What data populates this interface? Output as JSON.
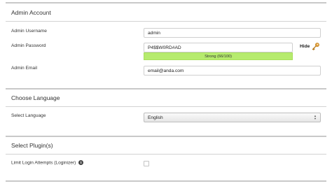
{
  "admin_account": {
    "title": "Admin Account",
    "username": {
      "label": "Admin Username",
      "value": "admin"
    },
    "password": {
      "label": "Admin Password",
      "value": "P4$$W0RD#AD",
      "strength_text": "Strong (66/100)",
      "strength_score": 66,
      "toggle_label": "Hide",
      "icon": "key-icon"
    },
    "email": {
      "label": "Admin Email",
      "value": "email@anda.com"
    }
  },
  "choose_language": {
    "title": "Choose Language",
    "select_label": "Select Language",
    "selected": "English"
  },
  "select_plugins": {
    "title": "Select Plugin(s)",
    "plugin_label": "Limit Login Attempts (Loginizer)",
    "checked": false
  },
  "colors": {
    "strength_bar": "#b6eb6e",
    "divider": "#c9c9c9"
  }
}
